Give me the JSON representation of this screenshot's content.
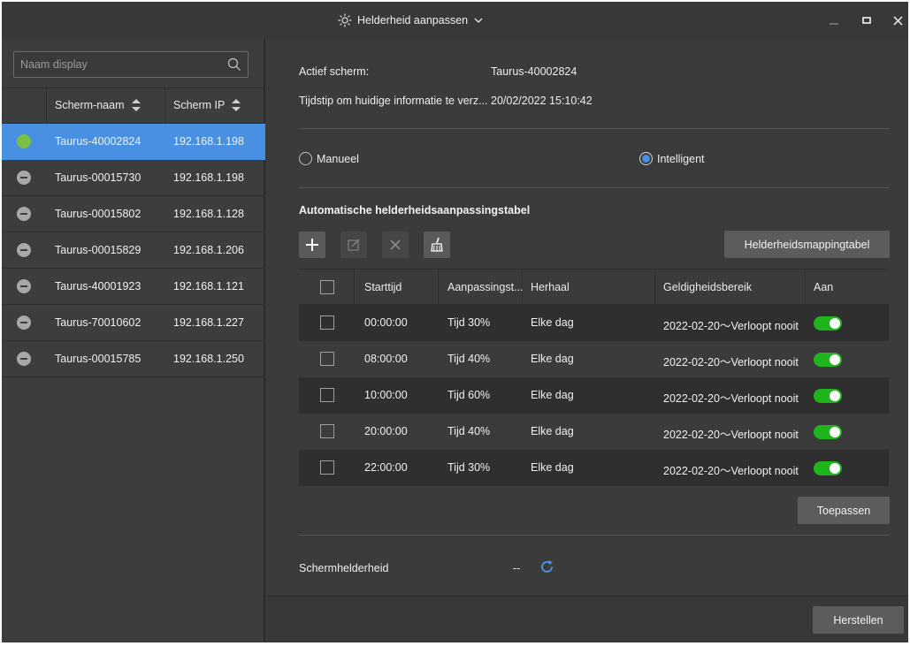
{
  "window": {
    "title": "Helderheid aanpassen",
    "title_icon": "sun-icon",
    "controls": {
      "minimize": "—",
      "maximize": "▫",
      "close": "✕"
    }
  },
  "sidebar": {
    "search": {
      "placeholder": "Naam display",
      "value": ""
    },
    "columns": {
      "name": "Scherm-naam",
      "ip": "Scherm IP"
    },
    "screens": [
      {
        "name": "Taurus-40002824",
        "ip": "192.168.1.198",
        "status": "online"
      },
      {
        "name": "Taurus-00015730",
        "ip": "192.168.1.198",
        "status": "offline"
      },
      {
        "name": "Taurus-00015802",
        "ip": "192.168.1.128",
        "status": "offline"
      },
      {
        "name": "Taurus-00015829",
        "ip": "192.168.1.206",
        "status": "offline"
      },
      {
        "name": "Taurus-40001923",
        "ip": "192.168.1.121",
        "status": "offline"
      },
      {
        "name": "Taurus-70010602",
        "ip": "192.168.1.227",
        "status": "offline"
      },
      {
        "name": "Taurus-00015785",
        "ip": "192.168.1.250",
        "status": "offline"
      }
    ]
  },
  "info": {
    "active_label": "Actief scherm:",
    "active_value": "Taurus-40002824",
    "time_label": "Tijdstip om huidige informatie te verz...",
    "time_value": "20/02/2022 15:10:42"
  },
  "mode": {
    "manual_label": "Manueel",
    "intelligent_label": "Intelligent",
    "selected": "intelligent"
  },
  "schedule": {
    "title": "Automatische helderheidsaanpassingstabel",
    "mapping_button": "Helderheidsmappingtabel",
    "columns": {
      "start": "Starttijd",
      "adjust": "Aanpassingst...",
      "repeat": "Herhaal",
      "validity": "Geldigheidsbereik",
      "enabled": "Aan"
    },
    "rows": [
      {
        "start": "00:00:00",
        "adjust": "Tijd 30%",
        "repeat": "Elke dag",
        "validity": "2022-02-20～Verloopt nooit",
        "enabled": true
      },
      {
        "start": "08:00:00",
        "adjust": "Tijd 40%",
        "repeat": "Elke dag",
        "validity": "2022-02-20～Verloopt nooit",
        "enabled": true
      },
      {
        "start": "10:00:00",
        "adjust": "Tijd 60%",
        "repeat": "Elke dag",
        "validity": "2022-02-20～Verloopt nooit",
        "enabled": true
      },
      {
        "start": "20:00:00",
        "adjust": "Tijd 40%",
        "repeat": "Elke dag",
        "validity": "2022-02-20～Verloopt nooit",
        "enabled": true
      },
      {
        "start": "22:00:00",
        "adjust": "Tijd 30%",
        "repeat": "Elke dag",
        "validity": "2022-02-20～Verloopt nooit",
        "enabled": true
      }
    ],
    "apply_button": "Toepassen"
  },
  "brightness": {
    "label": "Schermhelderheid",
    "value": "--"
  },
  "footer": {
    "reset_button": "Herstellen"
  },
  "colors": {
    "accent": "#4a90e2",
    "online": "#7ac143",
    "toggle_on": "#1fb51f"
  }
}
